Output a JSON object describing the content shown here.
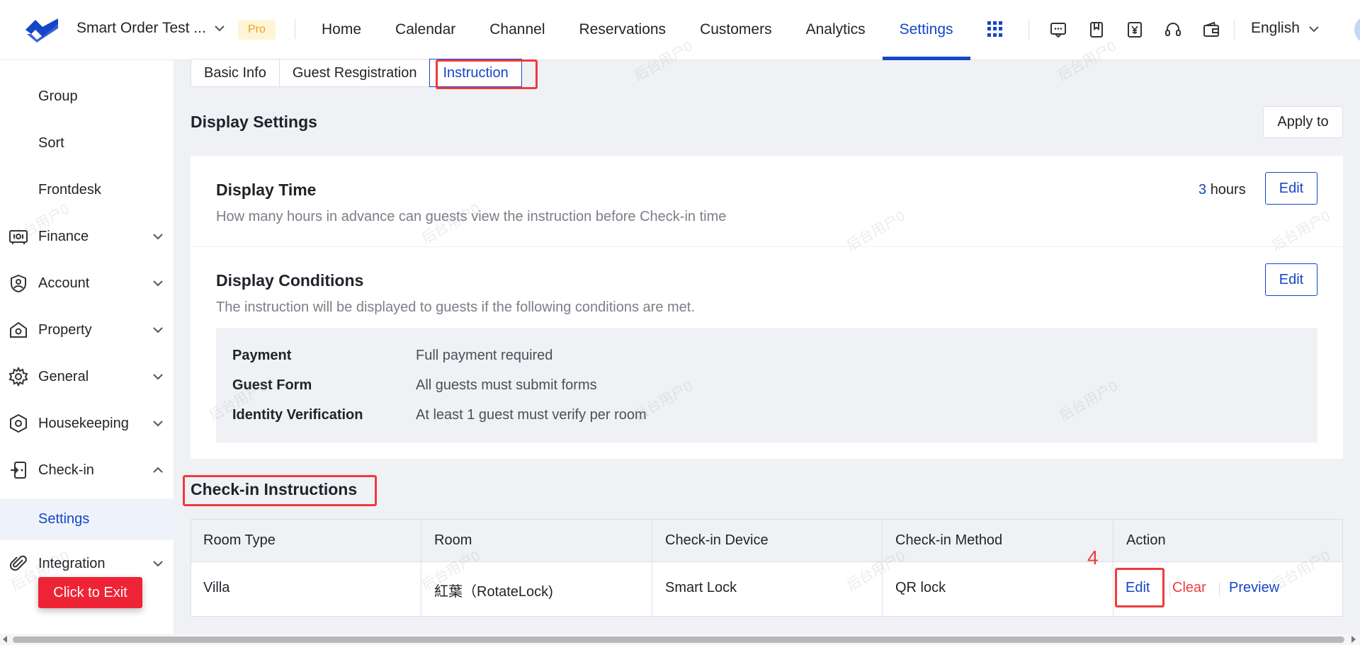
{
  "topbar": {
    "shop_name": "Smart Order Test ...",
    "pro_badge": "Pro",
    "nav": [
      "Home",
      "Calendar",
      "Channel",
      "Reservations",
      "Customers",
      "Analytics",
      "Settings"
    ],
    "active_nav": "Settings",
    "language": "English",
    "accent_color": "#1546c8"
  },
  "sidebar": {
    "items": [
      {
        "label": "Group",
        "icon": ""
      },
      {
        "label": "Sort",
        "icon": ""
      },
      {
        "label": "Frontdesk",
        "icon": ""
      },
      {
        "label": "Finance",
        "icon": "finance-icon"
      },
      {
        "label": "Account",
        "icon": "account-icon"
      },
      {
        "label": "Property",
        "icon": "property-icon"
      },
      {
        "label": "General",
        "icon": "gear-icon"
      },
      {
        "label": "Housekeeping",
        "icon": "housekeeping-icon"
      },
      {
        "label": "Check-in",
        "icon": "checkin-icon"
      },
      {
        "label": "Settings",
        "icon": ""
      },
      {
        "label": "Integration",
        "icon": "paperclip-icon"
      }
    ],
    "exit_button": "Click to Exit"
  },
  "tabs": [
    "Basic Info",
    "Guest Resgistration",
    "Instruction"
  ],
  "active_tab": "Instruction",
  "display_settings": {
    "title": "Display Settings",
    "apply_button": "Apply to",
    "display_time": {
      "title": "Display Time",
      "description": "How many hours in advance can guests view the instruction before Check-in time",
      "value": "3",
      "unit": "hours",
      "edit": "Edit"
    },
    "display_conditions": {
      "title": "Display Conditions",
      "description": "The instruction will be displayed to guests if the following conditions are met.",
      "edit": "Edit",
      "conditions": [
        {
          "label": "Payment",
          "value": "Full payment required"
        },
        {
          "label": "Guest Form",
          "value": "All guests must submit forms"
        },
        {
          "label": "Identity Verification",
          "value": "At least 1 guest must verify per room"
        }
      ]
    }
  },
  "checkin_instructions": {
    "title": "Check-in Instructions",
    "columns": [
      "Room Type",
      "Room",
      "Check-in Device",
      "Check-in Method",
      "Action"
    ],
    "rows": [
      {
        "room_type": "Villa",
        "room": "紅葉（RotateLock)",
        "device": "Smart Lock",
        "method": "QR lock",
        "actions": [
          "Edit",
          "Clear",
          "Preview"
        ]
      }
    ]
  },
  "annotation_step": "4",
  "watermark": "后台用户0"
}
